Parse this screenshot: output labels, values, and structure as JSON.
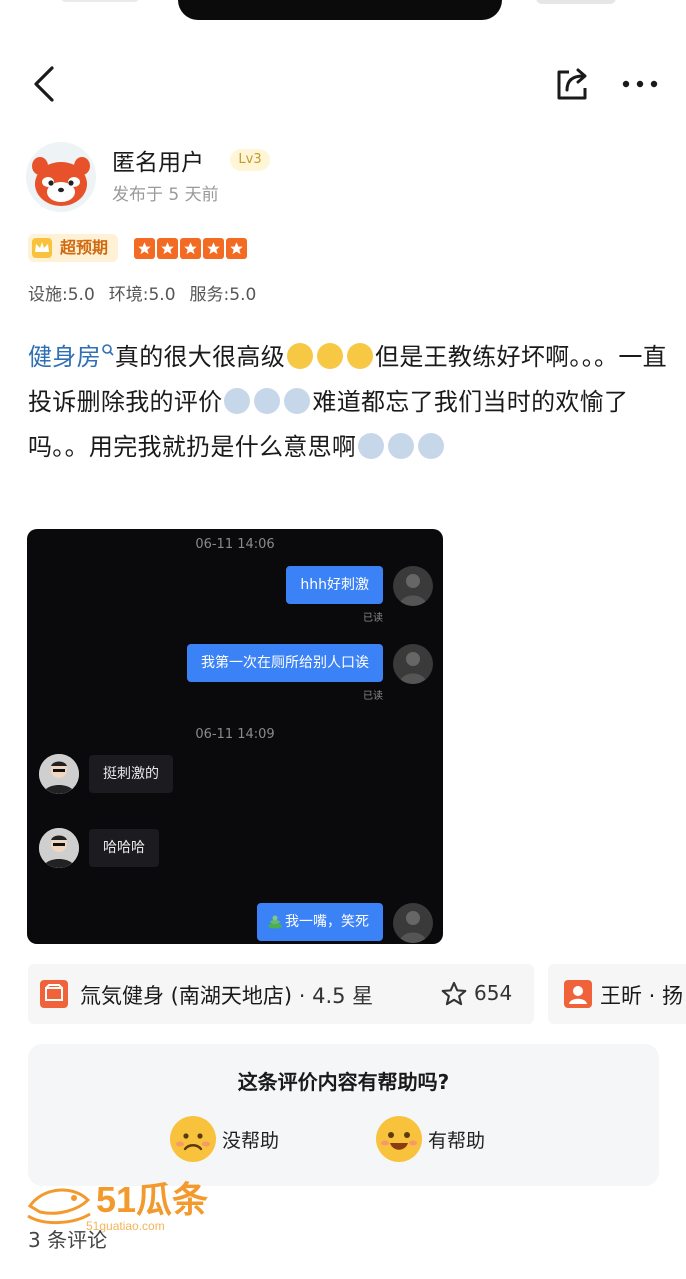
{
  "header": {
    "back_icon": "chevron-left-icon",
    "share_icon": "share-icon",
    "more_icon": "more-dots-icon"
  },
  "author": {
    "name": "匿名用户",
    "level": "Lv3",
    "posted": "发布于 5 天前"
  },
  "rating": {
    "tag": "超预期",
    "stars": 5,
    "scores": [
      "设施:5.0",
      "环境:5.0",
      "服务:5.0"
    ]
  },
  "review": {
    "link_text": "健身房",
    "part1": "真的很大很高级",
    "part2": "但是王教练好坏啊。。。一直投诉删除我的评价",
    "part3": "难道都忘了我们当时的欢愉了吗。。用完我就扔是什么意思啊"
  },
  "chat": {
    "time1": "06-11 14:06",
    "msg1": "hhh好刺激",
    "read1": "已读",
    "msg2": "我第一次在厕所给别人口诶",
    "read2": "已读",
    "time2": "06-11 14:09",
    "msg3": "挺刺激的",
    "msg4": "哈哈哈",
    "msg5": "我一嘴，笑死"
  },
  "shop": {
    "name": "氚気健身 (南湖天地店)",
    "rating": "· 4.5 星",
    "fav_count": "654"
  },
  "coach": {
    "name": "王昕 · 扬"
  },
  "helpful": {
    "question": "这条评价内容有帮助吗?",
    "no_label": "没帮助",
    "yes_label": "有帮助"
  },
  "footer": {
    "comment_count": "3 条评论",
    "watermark": "51瓜条",
    "watermark_url": "51guatiao.com"
  },
  "colors": {
    "accent": "#f36a22",
    "link": "#2f6fb3",
    "bubble": "#3b82f6"
  }
}
